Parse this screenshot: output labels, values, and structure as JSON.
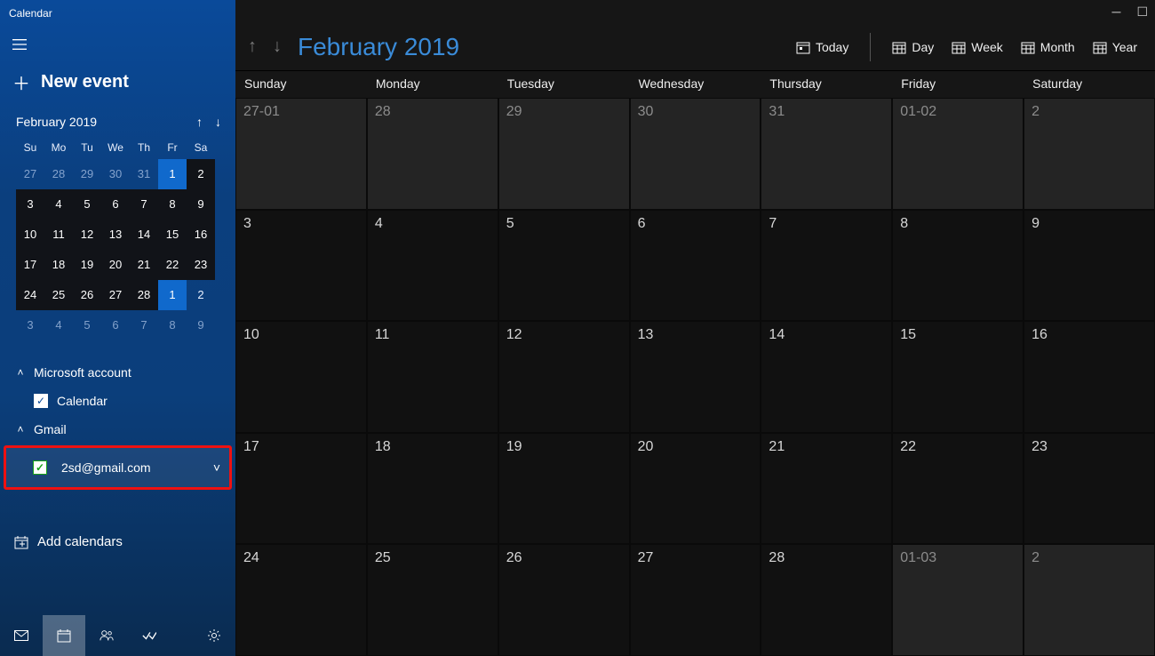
{
  "app_title": "Calendar",
  "new_event_label": "New event",
  "mini": {
    "month_label": "February 2019",
    "dow": [
      "Su",
      "Mo",
      "Tu",
      "We",
      "Th",
      "Fr",
      "Sa"
    ],
    "rows": [
      [
        {
          "d": "27",
          "dim": true
        },
        {
          "d": "28",
          "dim": true
        },
        {
          "d": "29",
          "dim": true
        },
        {
          "d": "30",
          "dim": true
        },
        {
          "d": "31",
          "dim": true
        },
        {
          "d": "1",
          "dark": true,
          "sel": true
        },
        {
          "d": "2",
          "dark": true
        }
      ],
      [
        {
          "d": "3",
          "dark": true
        },
        {
          "d": "4",
          "dark": true
        },
        {
          "d": "5",
          "dark": true
        },
        {
          "d": "6",
          "dark": true
        },
        {
          "d": "7",
          "dark": true
        },
        {
          "d": "8",
          "dark": true
        },
        {
          "d": "9",
          "dark": true
        }
      ],
      [
        {
          "d": "10",
          "dark": true
        },
        {
          "d": "11",
          "dark": true
        },
        {
          "d": "12",
          "dark": true
        },
        {
          "d": "13",
          "dark": true
        },
        {
          "d": "14",
          "dark": true
        },
        {
          "d": "15",
          "dark": true
        },
        {
          "d": "16",
          "dark": true
        }
      ],
      [
        {
          "d": "17",
          "dark": true
        },
        {
          "d": "18",
          "dark": true
        },
        {
          "d": "19",
          "dark": true
        },
        {
          "d": "20",
          "dark": true
        },
        {
          "d": "21",
          "dark": true
        },
        {
          "d": "22",
          "dark": true
        },
        {
          "d": "23",
          "dark": true
        }
      ],
      [
        {
          "d": "24",
          "dark": true
        },
        {
          "d": "25",
          "dark": true
        },
        {
          "d": "26",
          "dark": true
        },
        {
          "d": "27",
          "dark": true
        },
        {
          "d": "28",
          "dark": true
        },
        {
          "d": "1",
          "sel": true
        },
        {
          "d": "2"
        }
      ],
      [
        {
          "d": "3",
          "dim": true
        },
        {
          "d": "4",
          "dim": true
        },
        {
          "d": "5",
          "dim": true
        },
        {
          "d": "6",
          "dim": true
        },
        {
          "d": "7",
          "dim": true
        },
        {
          "d": "8",
          "dim": true
        },
        {
          "d": "9",
          "dim": true
        }
      ]
    ]
  },
  "accounts": {
    "ms": {
      "label": "Microsoft account",
      "calendar_label": "Calendar"
    },
    "gmail": {
      "label": "Gmail",
      "email": "2sd@gmail.com"
    }
  },
  "add_calendars_label": "Add calendars",
  "topbar": {
    "month_label": "February 2019",
    "today": "Today",
    "views": [
      "Day",
      "Week",
      "Month",
      "Year"
    ]
  },
  "dow_full": [
    "Sunday",
    "Monday",
    "Tuesday",
    "Wednesday",
    "Thursday",
    "Friday",
    "Saturday"
  ],
  "grid": [
    [
      {
        "t": "27-01",
        "o": true
      },
      {
        "t": "28",
        "o": true
      },
      {
        "t": "29",
        "o": true
      },
      {
        "t": "30",
        "o": true
      },
      {
        "t": "31",
        "o": true
      },
      {
        "t": "01-02",
        "o": true
      },
      {
        "t": "2",
        "o": true
      }
    ],
    [
      {
        "t": "3"
      },
      {
        "t": "4"
      },
      {
        "t": "5"
      },
      {
        "t": "6"
      },
      {
        "t": "7"
      },
      {
        "t": "8"
      },
      {
        "t": "9"
      }
    ],
    [
      {
        "t": "10"
      },
      {
        "t": "11"
      },
      {
        "t": "12"
      },
      {
        "t": "13"
      },
      {
        "t": "14"
      },
      {
        "t": "15"
      },
      {
        "t": "16"
      }
    ],
    [
      {
        "t": "17"
      },
      {
        "t": "18"
      },
      {
        "t": "19"
      },
      {
        "t": "20"
      },
      {
        "t": "21"
      },
      {
        "t": "22"
      },
      {
        "t": "23"
      }
    ],
    [
      {
        "t": "24"
      },
      {
        "t": "25"
      },
      {
        "t": "26"
      },
      {
        "t": "27"
      },
      {
        "t": "28"
      },
      {
        "t": "01-03",
        "o": true
      },
      {
        "t": "2",
        "o": true
      }
    ]
  ]
}
